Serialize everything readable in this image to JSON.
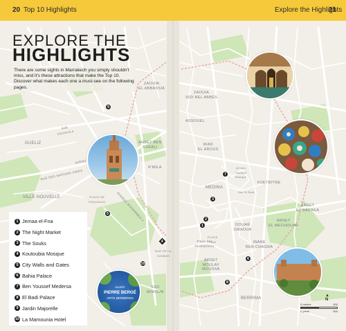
{
  "header": {
    "left_page_number": "20",
    "left_title": "Top 10 Highlights",
    "right_title": "Explore the Highlights",
    "right_page_number": "21"
  },
  "intro": {
    "title_line1": "EXPLORE THE",
    "title_line2": "HIGHLIGHTS",
    "body": "There are some sights in Marrakech you simply shouldn't miss, and it's these attractions that make the Top 10. Discover what makes each one a must-see on the following pages."
  },
  "legend": [
    {
      "num": "1",
      "label": "Jemaa el-Fna"
    },
    {
      "num": "2",
      "label": "The Night Market"
    },
    {
      "num": "3",
      "label": "The Souks"
    },
    {
      "num": "4",
      "label": "Koutoubia Mosque"
    },
    {
      "num": "5",
      "label": "City Walls and Gates"
    },
    {
      "num": "6",
      "label": "Bahia Palace"
    },
    {
      "num": "7",
      "label": "Ben Youssef Medersa"
    },
    {
      "num": "8",
      "label": "El Badi Palace"
    },
    {
      "num": "9",
      "label": "Jardin Majorelle"
    },
    {
      "num": "10",
      "label": "La Mamounia Hotel"
    }
  ],
  "map_labels": {
    "zaouia_abbassia": "ZAOUIA\nEL ABBASSIA",
    "gueliz": "GUELIZ",
    "arset_chebli": "ARSET BEN\nCHEBLI",
    "r_mila": "R'MILA",
    "ville_nouvelle": "VILLE NOUVELLE",
    "sidi_mimoun": "SIDI\nMIMOUN",
    "zaouia_sidi": "ZAOUIA\nSIDI BEL ABBES",
    "assouel": "ASSOUEL",
    "riad_arous": "RIAD\nEL AROUS",
    "medina": "MEDINA",
    "ksetbiyne": "KSETBIYNE",
    "arset_baraka": "ARSET\nEL BARAKA",
    "arset_mechouar": "ARSET\nEL MECHOUAR",
    "douar_graoua": "DOUAR\nGRAOUA",
    "inane_chagra": "INANE\nBEN CHAGRA",
    "arset_moulay": "ARSET\nMOULAY\nMOUSSA",
    "berrima": "BERRIMA",
    "place_ferblantiers": "Place des\nFerblantiers",
    "avenue_hassan": "AVENUE HASSAN II",
    "avenue_mohammed": "AVENUE MOHAMMED V",
    "rue_nations": "RUE DES NATIONS UNIES",
    "place_foucauld": "PLACE DE\nFOUCAULD",
    "mosque_label": "Ali ben\nYoussef\nMosque",
    "dar_label": "Dar Si Said",
    "place_label": "PLACE\nFAIH",
    "rue_label": "RUE DE LA\nKASBAH",
    "bab_label": "BAB\nDOUKKALA"
  },
  "markers": [
    {
      "num": "9"
    },
    {
      "num": "4"
    },
    {
      "num": "5"
    },
    {
      "num": "10"
    },
    {
      "num": "7"
    },
    {
      "num": "3"
    },
    {
      "num": "2"
    },
    {
      "num": "1"
    },
    {
      "num": "6"
    },
    {
      "num": "8"
    }
  ],
  "photo_texts": {
    "majorelle_line1": "PIERRE BERGÉ",
    "majorelle_line2": "ARTS BERBÈRES",
    "majorelle_top": "MUSÉE"
  },
  "scale": {
    "top_left": "0 metres",
    "top_right": "500",
    "bottom_left": "0 yards",
    "bottom_right": "500"
  },
  "compass": "N",
  "colors": {
    "header_yellow": "#f6c93a",
    "map_background": "#f2efe8",
    "road": "#ffffff",
    "park_green": "#cfe6b8",
    "marker": "#1f1f1f"
  }
}
